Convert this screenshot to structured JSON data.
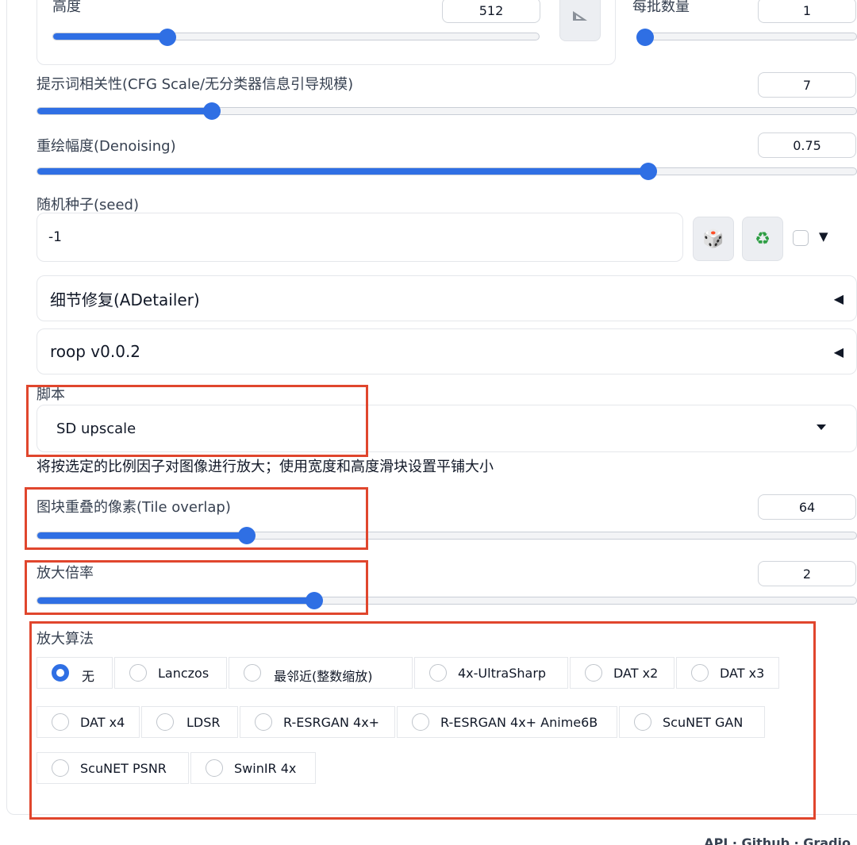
{
  "dimensions": {
    "height_label": "高度",
    "height_value": "512",
    "height_fraction": 0.26,
    "batch_label": "每批数量",
    "batch_value": "1",
    "batch_fraction": 0.0
  },
  "cfg": {
    "label": "提示词相关性(CFG Scale/无分类器信息引导规模)",
    "value": "7",
    "fraction": 0.22
  },
  "denoise": {
    "label": "重绘幅度(Denoising)",
    "value": "0.75",
    "fraction": 0.75
  },
  "seed": {
    "label": "随机种子(seed)",
    "value": "-1"
  },
  "accordions": {
    "adetailer": "细节修复(ADetailer)",
    "roop": "roop v0.0.2"
  },
  "script": {
    "label": "脚本",
    "selected": "SD upscale",
    "description": "将按选定的比例因子对图像进行放大；使用宽度和高度滑块设置平铺大小"
  },
  "tile_overlap": {
    "label": "图块重叠的像素(Tile overlap)",
    "value": "64",
    "fraction": 0.25
  },
  "scale": {
    "label": "放大倍率",
    "value": "2",
    "fraction": 0.34
  },
  "upscaler": {
    "label": "放大算法",
    "selected": "无",
    "options": [
      "无",
      "Lanczos",
      "最邻近(整数缩放)",
      "4x-UltraSharp",
      "DAT x2",
      "DAT x3",
      "DAT x4",
      "LDSR",
      "R-ESRGAN 4x+",
      "R-ESRGAN 4x+ Anime6B",
      "ScuNET GAN",
      "ScuNET PSNR",
      "SwinIR 4x"
    ]
  },
  "footer": "API  ·  Github  ·  Gradio",
  "colors": {
    "accent": "#2f6fe4",
    "highlight_box": "#e0462d"
  }
}
